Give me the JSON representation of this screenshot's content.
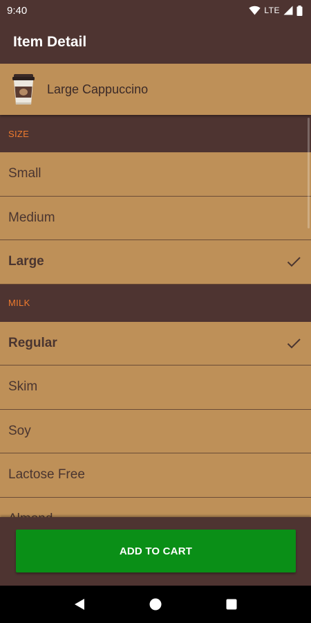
{
  "status_bar": {
    "time": "9:40",
    "network": "LTE",
    "icons": [
      "wifi-icon",
      "signal-icon",
      "battery-icon"
    ]
  },
  "app_bar": {
    "title": "Item Detail"
  },
  "item": {
    "name": "Large Cappuccino",
    "icon": "coffee-cup-icon"
  },
  "sections": {
    "size": {
      "header": "SIZE",
      "options": [
        {
          "label": "Small",
          "selected": false
        },
        {
          "label": "Medium",
          "selected": false
        },
        {
          "label": "Large",
          "selected": true
        }
      ]
    },
    "milk": {
      "header": "MILK",
      "options": [
        {
          "label": "Regular",
          "selected": true
        },
        {
          "label": "Skim",
          "selected": false
        },
        {
          "label": "Soy",
          "selected": false
        },
        {
          "label": "Lactose Free",
          "selected": false
        },
        {
          "label": "Almond",
          "selected": false
        }
      ]
    }
  },
  "actions": {
    "add_to_cart": "ADD TO CART"
  },
  "colors": {
    "primary_dark": "#4e3431",
    "option_bg": "#be9058",
    "section_label": "#ef7b2e",
    "button_green": "#0a8f17"
  },
  "nav": {
    "icons": [
      "back-icon",
      "home-icon",
      "recents-icon"
    ]
  }
}
